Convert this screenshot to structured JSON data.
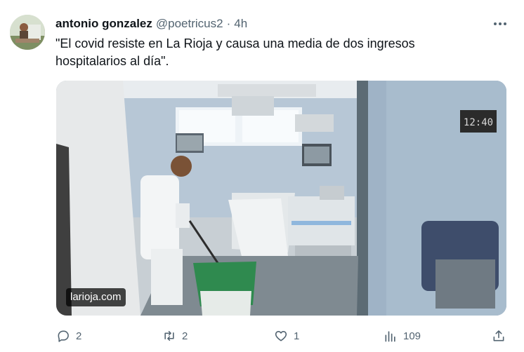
{
  "tweet": {
    "author_name": "antonio gonzalez",
    "author_handle": "@poetricus2",
    "separator": "·",
    "time": "4h",
    "text": "\"El covid resiste en La Rioja y causa una media de dos ingresos hospitalarios al día\".",
    "media": {
      "source": "larioja.com",
      "clock_display": "12:40"
    }
  },
  "actions": {
    "replies": "2",
    "retweets": "2",
    "likes": "1",
    "views": "109"
  },
  "icons": {
    "more": "more-dots-icon",
    "reply": "reply-bubble-icon",
    "retweet": "retweet-icon",
    "like": "heart-icon",
    "views": "views-bar-chart-icon",
    "share": "share-upload-icon"
  },
  "colors": {
    "text_primary": "#0f1419",
    "text_secondary": "#536471"
  }
}
